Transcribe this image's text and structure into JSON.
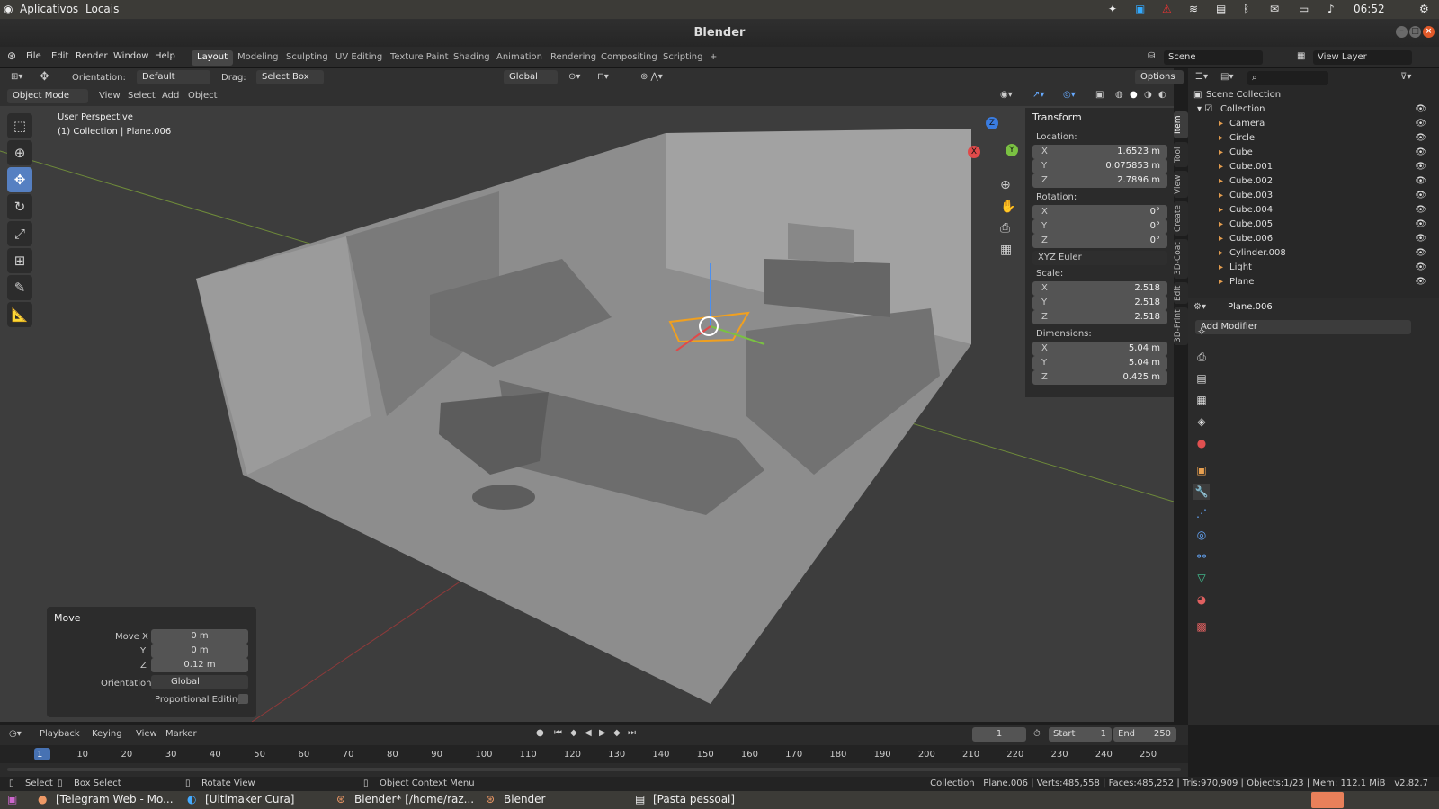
{
  "os_bar": {
    "apps": "Aplicativos",
    "places": "Locais",
    "clock": "06:52"
  },
  "window": {
    "title": "Blender"
  },
  "menu": [
    "File",
    "Edit",
    "Render",
    "Window",
    "Help"
  ],
  "workspaces": [
    "Layout",
    "Modeling",
    "Sculpting",
    "UV Editing",
    "Texture Paint",
    "Shading",
    "Animation",
    "Rendering",
    "Compositing",
    "Scripting",
    "+"
  ],
  "scene": {
    "scene_name": "Scene",
    "view_layer": "View Layer"
  },
  "tool_header": {
    "orientation_label": "Orientation:",
    "orientation_value": "Default",
    "drag_label": "Drag:",
    "drag_value": "Select Box",
    "transform_orientation": "Global",
    "options": "Options"
  },
  "viewport_header": {
    "mode": "Object Mode",
    "items": [
      "View",
      "Select",
      "Add",
      "Object"
    ]
  },
  "viewport": {
    "perspective": "User Perspective",
    "context": "(1) Collection | Plane.006"
  },
  "gizmo": {
    "x": "X",
    "y": "Y",
    "z": "Z"
  },
  "transform": {
    "title": "Transform",
    "location_label": "Location:",
    "location": [
      {
        "axis": "X",
        "value": "1.6523 m"
      },
      {
        "axis": "Y",
        "value": "0.075853 m"
      },
      {
        "axis": "Z",
        "value": "2.7896 m"
      }
    ],
    "rotation_label": "Rotation:",
    "rotation": [
      {
        "axis": "X",
        "value": "0°"
      },
      {
        "axis": "Y",
        "value": "0°"
      },
      {
        "axis": "Z",
        "value": "0°"
      }
    ],
    "rotation_mode": "XYZ Euler",
    "scale_label": "Scale:",
    "scale": [
      {
        "axis": "X",
        "value": "2.518"
      },
      {
        "axis": "Y",
        "value": "2.518"
      },
      {
        "axis": "Z",
        "value": "2.518"
      }
    ],
    "dimensions_label": "Dimensions:",
    "dimensions": [
      {
        "axis": "X",
        "value": "5.04 m"
      },
      {
        "axis": "Y",
        "value": "5.04 m"
      },
      {
        "axis": "Z",
        "value": "0.425 m"
      }
    ]
  },
  "side_tabs": [
    "Item",
    "Tool",
    "View",
    "Create",
    "3D-Coat",
    "Edit",
    "3D-Print"
  ],
  "outliner": {
    "root": "Scene Collection",
    "collection": "Collection",
    "items": [
      "Camera",
      "Circle",
      "Cube",
      "Cube.001",
      "Cube.002",
      "Cube.003",
      "Cube.004",
      "Cube.005",
      "Cube.006",
      "Cylinder.008",
      "Light",
      "Plane"
    ]
  },
  "properties": {
    "object": "Plane.006",
    "add_modifier": "Add Modifier"
  },
  "move_panel": {
    "title": "Move",
    "move_x_label": "Move X",
    "move_x": "0 m",
    "y_label": "Y",
    "y": "0 m",
    "z_label": "Z",
    "z": "0.12 m",
    "orientation_label": "Orientation",
    "orientation": "Global",
    "proportional": "Proportional Editing"
  },
  "timeline": {
    "menus": [
      "Playback",
      "Keying",
      "View",
      "Marker"
    ],
    "current_frame": "1",
    "start_label": "Start",
    "start": "1",
    "end_label": "End",
    "end": "250",
    "ticks": [
      "1",
      "10",
      "20",
      "30",
      "40",
      "50",
      "60",
      "70",
      "80",
      "90",
      "100",
      "110",
      "120",
      "130",
      "140",
      "150",
      "160",
      "170",
      "180",
      "190",
      "200",
      "210",
      "220",
      "230",
      "240",
      "250"
    ]
  },
  "status": {
    "select": "Select",
    "box_select": "Box Select",
    "rotate_view": "Rotate View",
    "context_menu": "Object Context Menu",
    "stats": "Collection | Plane.006 | Verts:485,558 | Faces:485,252 | Tris:970,909 | Objects:1/23 | Mem: 112.1 MiB | v2.82.7"
  },
  "taskbar": [
    "[Telegram Web - Mo...",
    "[Ultimaker Cura]",
    "Blender* [/home/raz...",
    "Blender",
    "[Pasta pessoal]"
  ]
}
